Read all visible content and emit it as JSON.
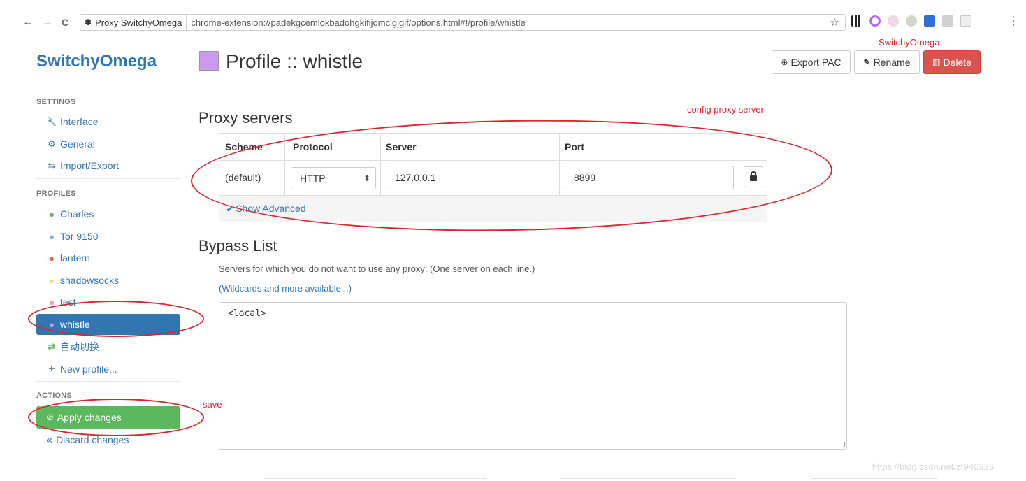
{
  "browser": {
    "tab_label": "Proxy SwitchyOmega",
    "url": "chrome-extension://padekgcemlokbadohgkifijomclgjgif/options.html#!/profile/whistle",
    "back_glyph": "←",
    "forward_glyph": "→",
    "reload_glyph": "C",
    "bookmark_glyph": "☆",
    "menu_glyph": "⋮",
    "extension_colors": [
      "#222222",
      "#b36bff",
      "#f0d6e6",
      "#cfd8c4",
      "#2f6fd6",
      "#d0d0d0",
      "#c8c8c8"
    ]
  },
  "annotations": {
    "top_right": "SwitchyOmega",
    "proxy": "config proxy server",
    "save": "save"
  },
  "sidebar": {
    "brand": "SwitchyOmega",
    "settings_heading": "SETTINGS",
    "settings": [
      {
        "label": "Interface",
        "icon": "wrench-icon",
        "glyph": "🔧"
      },
      {
        "label": "General",
        "icon": "gear-icon",
        "glyph": "⚙"
      },
      {
        "label": "Import/Export",
        "icon": "import-export-icon",
        "glyph": "⇆"
      }
    ],
    "profiles_heading": "PROFILES",
    "profiles": [
      {
        "label": "Charles",
        "icon": "globe-icon",
        "color": "#5cb85c"
      },
      {
        "label": "Tor 9150",
        "icon": "globe-icon",
        "color": "#6aaee0"
      },
      {
        "label": "lantern",
        "icon": "globe-icon",
        "color": "#e8643c"
      },
      {
        "label": "shadowsocks",
        "icon": "globe-icon",
        "color": "#f3d57a"
      },
      {
        "label": "test",
        "icon": "globe-icon",
        "color": "#f0a080"
      },
      {
        "label": "whistle",
        "icon": "globe-icon",
        "color": "#cc99ee"
      },
      {
        "label": "自动切换",
        "icon": "switch-icon",
        "color": "#5cb85c"
      },
      {
        "label": "New profile...",
        "icon": "plus-icon",
        "color": "#3276b1"
      }
    ],
    "actions_heading": "ACTIONS",
    "apply": "Apply changes",
    "discard": "Discard changes"
  },
  "header": {
    "title": "Profile :: whistle",
    "swatch_color": "#cc99ee",
    "export": "Export PAC",
    "rename": "Rename",
    "delete": "Delete"
  },
  "proxy": {
    "heading": "Proxy servers",
    "columns": [
      "Scheme",
      "Protocol",
      "Server",
      "Port"
    ],
    "scheme": "(default)",
    "protocol": "HTTP",
    "server": "127.0.0.1",
    "port": "8899",
    "show_advanced": "Show Advanced"
  },
  "bypass": {
    "heading": "Bypass List",
    "help": "Servers for which you do not want to use any proxy: (One server on each line.)",
    "help_link": "(Wildcards and more available...)",
    "content": "<local>"
  },
  "watermark": "https://blog.csdn.net/zr940326"
}
